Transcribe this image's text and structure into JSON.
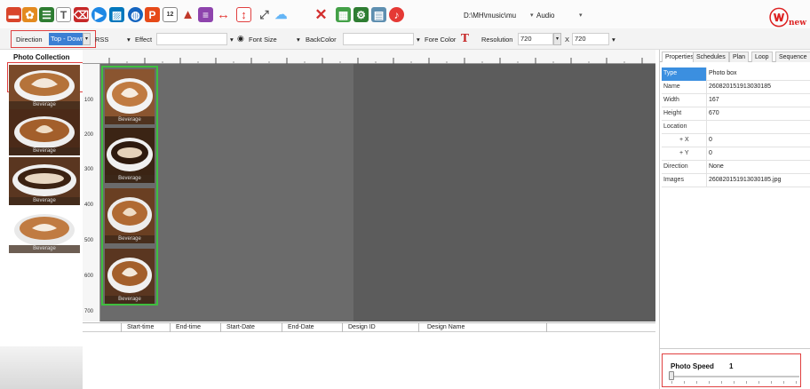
{
  "toolbar": {
    "audio_path": "D:\\MH\\music\\mu",
    "audio_label": "Audio",
    "icons": [
      "open-folder-icon",
      "settings-gear-icon",
      "list-icon",
      "text-tool-icon",
      "erase-icon",
      "play-icon",
      "image-icon",
      "globe-icon",
      "ppt-icon",
      "clock-icon",
      "pyramid-icon",
      "marquee-icon",
      "horizontal-move-icon",
      "vertical-move-icon",
      "resize-icon",
      "cloud-icon",
      "delete-icon",
      "database-icon",
      "network-icon",
      "server-icon",
      "audio-icon"
    ],
    "logo_text": "new"
  },
  "format_bar": {
    "direction_label": "Direction",
    "direction_value": "Top - Down",
    "rss_label": "RSS",
    "effect_label": "Effect",
    "font_size_label": "Font Size",
    "backcolor_label": "BackColor",
    "forecolor_label": "Fore Color",
    "resolution_label": "Resolution",
    "resolution_width": "720",
    "x_label": "X",
    "resolution_height": "720"
  },
  "collection": {
    "title": "Photo Collection",
    "items": [
      {
        "label": "Beverage"
      },
      {
        "label": "Beverage"
      },
      {
        "label": "Beverage"
      },
      {
        "label": "Beverage"
      }
    ]
  },
  "photobox": {
    "items": [
      {
        "label": "Beverage"
      },
      {
        "label": "Beverage"
      },
      {
        "label": "Beverage"
      },
      {
        "label": "Beverage"
      }
    ]
  },
  "ruler": {
    "left_marks": [
      "100",
      "200",
      "300",
      "400",
      "500",
      "600",
      "700"
    ]
  },
  "schedule": {
    "columns": [
      "Start-time",
      "End-time",
      "Start-Date",
      "End-Date",
      "Design ID",
      "Design Name"
    ]
  },
  "properties": {
    "tabs": [
      "Properties",
      "Schedules",
      "Plan",
      "Loop",
      "Sequence"
    ],
    "rows": [
      {
        "key": "Type",
        "value": "Photo box"
      },
      {
        "key": "Name",
        "value": "260820151913030185"
      },
      {
        "key": "Width",
        "value": "167"
      },
      {
        "key": "Height",
        "value": "670"
      },
      {
        "key": "Location",
        "value": ""
      },
      {
        "key": "+ X",
        "value": "0"
      },
      {
        "key": "+ Y",
        "value": "0"
      },
      {
        "key": "Direction",
        "value": "None"
      },
      {
        "key": "Images",
        "value": "260820151913030185.jpg"
      }
    ],
    "speed_label": "Photo Speed",
    "speed_value": "1",
    "speed_level": 1
  },
  "colors": {
    "accent": "#3b7fd4",
    "selection_outline": "#e04040",
    "photobox_border": "#3fbf3f",
    "canvas": "#6b6b6b"
  }
}
